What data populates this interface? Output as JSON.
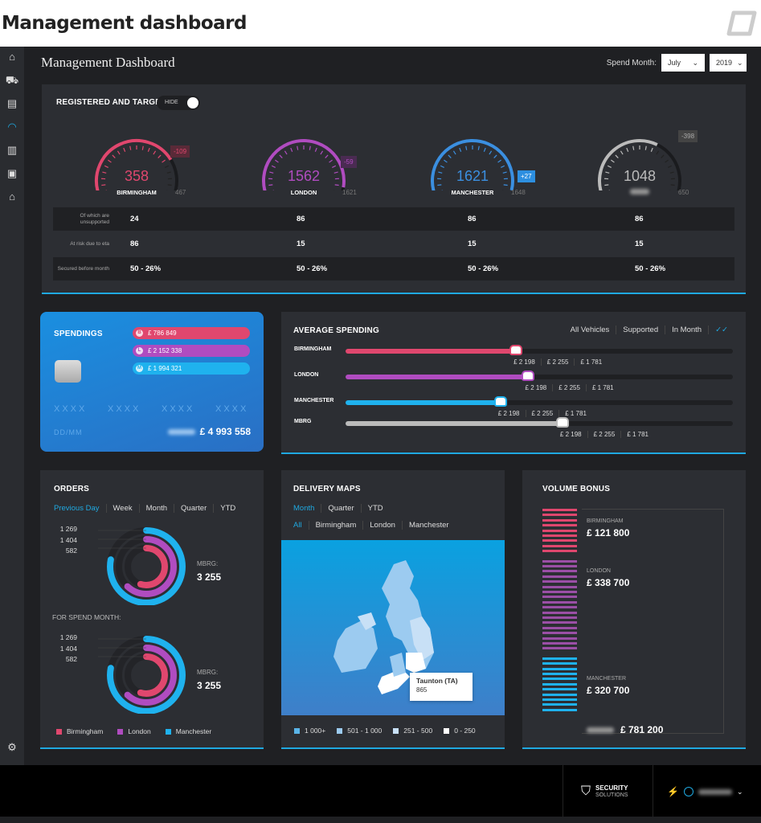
{
  "page_title": "Management dashboard",
  "header": {
    "title": "Management Dashboard",
    "spend_month_label": "Spend Month:",
    "month": "July",
    "year": "2019"
  },
  "sidebar": {
    "items": [
      {
        "icon": "home-icon",
        "glyph": "⌂"
      },
      {
        "icon": "car-icon",
        "glyph": "⛟"
      },
      {
        "icon": "list-icon",
        "glyph": "▤"
      },
      {
        "icon": "gauge-icon",
        "glyph": "◠"
      },
      {
        "icon": "bar-chart-icon",
        "glyph": "▥"
      },
      {
        "icon": "document-icon",
        "glyph": "▣"
      },
      {
        "icon": "lock-icon",
        "glyph": "⌂"
      }
    ],
    "settings_icon": "gear-icon"
  },
  "registered": {
    "title": "REGISTERED AND TARGET",
    "toggle_label": "HIDE",
    "gauges": [
      {
        "city": "BIRMINGHAM",
        "value": "358",
        "target": "467",
        "diff": "-109",
        "color": "#e0476e",
        "diff_bg": "#5a2a38",
        "diff_color": "#e0476e",
        "fraction": 0.77
      },
      {
        "city": "LONDON",
        "value": "1562",
        "target": "1621",
        "diff": "-59",
        "color": "#b04cc0",
        "diff_bg": "#4a2b52",
        "diff_color": "#b04cc0",
        "fraction": 0.96
      },
      {
        "city": "MANCHESTER",
        "value": "1621",
        "target": "1648",
        "diff": "+27",
        "color": "#3b8fe0",
        "diff_bg": "#2d8fe0",
        "diff_color": "#ffffff",
        "fraction": 0.98
      },
      {
        "city": "",
        "value": "1048",
        "target": "650",
        "diff": "-398",
        "color": "#bbbbbb",
        "diff_bg": "#444",
        "diff_color": "#aaa",
        "fraction": 0.62
      }
    ],
    "rows": [
      {
        "label": "Of which are unsupported",
        "values": [
          "24",
          "86",
          "86",
          "86"
        ]
      },
      {
        "label": "At risk due to eta",
        "values": [
          "86",
          "15",
          "15",
          "15"
        ]
      },
      {
        "label": "Secured before month",
        "values": [
          "50 - 26%",
          "50 - 26%",
          "50 - 26%",
          "50 - 26%"
        ]
      }
    ]
  },
  "spendings": {
    "title": "SPENDINGS",
    "items": [
      {
        "letter": "B",
        "amount": "£ 786 849",
        "color": "#e0476e"
      },
      {
        "letter": "L",
        "amount": "£ 2 152 338",
        "color": "#b04cc0"
      },
      {
        "letter": "M",
        "amount": "£ 1 994 321",
        "color": "#1fb2ee"
      }
    ],
    "card_number": [
      "XXXX",
      "XXXX",
      "XXXX",
      "XXXX"
    ],
    "expiry": "DD/MM",
    "total": "£ 4 993 558"
  },
  "average_spending": {
    "title": "AVERAGE SPENDING",
    "filters": [
      "All Vehicles",
      "Supported",
      "In Month"
    ],
    "check_icon": "double-check-icon",
    "rows": [
      {
        "name": "BIRMINGHAM",
        "fraction": 0.44,
        "color": "#e0476e",
        "values": [
          "£ 2 198",
          "£ 2 255",
          "£ 1 781"
        ]
      },
      {
        "name": "LONDON",
        "fraction": 0.47,
        "color": "#b04cc0",
        "values": [
          "£ 2 198",
          "£ 2 255",
          "£ 1 781"
        ]
      },
      {
        "name": "MANCHESTER",
        "fraction": 0.4,
        "color": "#1fb2ee",
        "values": [
          "£ 2 198",
          "£ 2 255",
          "£ 1 781"
        ]
      },
      {
        "name": "MBRG",
        "fraction": 0.56,
        "color": "#bbbbbb",
        "values": [
          "£ 2 198",
          "£ 2 255",
          "£ 1 781"
        ]
      }
    ]
  },
  "orders": {
    "title": "ORDERS",
    "tabs": [
      "Previous Day",
      "Week",
      "Month",
      "Quarter",
      "YTD"
    ],
    "active_tab": "Previous Day",
    "charts": [
      {
        "heading": "",
        "ring_labels": [
          "1 269",
          "1 404",
          "582"
        ],
        "total_label": "MBRG:",
        "total": "3 255"
      },
      {
        "heading": "FOR SPEND MONTH:",
        "ring_labels": [
          "1 269",
          "1 404",
          "582"
        ],
        "total_label": "MBRG:",
        "total": "3 255"
      }
    ],
    "rings": [
      {
        "name": "Manchester",
        "color": "#1fb2ee",
        "fraction": 0.78
      },
      {
        "name": "London",
        "color": "#b04cc0",
        "fraction": 0.62
      },
      {
        "name": "Birmingham",
        "color": "#e0476e",
        "fraction": 0.55
      }
    ],
    "legend": [
      {
        "name": "Birmingham",
        "color": "#e0476e"
      },
      {
        "name": "London",
        "color": "#b04cc0"
      },
      {
        "name": "Manchester",
        "color": "#1fb2ee"
      }
    ]
  },
  "delivery": {
    "title": "DELIVERY MAPS",
    "period_tabs": [
      "Month",
      "Quarter",
      "YTD"
    ],
    "region_tabs": [
      "All",
      "Birmingham",
      "London",
      "Manchester"
    ],
    "tooltip": {
      "name": "Taunton (TA)",
      "value": "865"
    },
    "legend": [
      {
        "label": "1 000+",
        "color": "#5ab4e8"
      },
      {
        "label": "501 - 1 000",
        "color": "#9ccbf0"
      },
      {
        "label": "251 - 500",
        "color": "#c8e0f6"
      },
      {
        "label": "0 - 250",
        "color": "#ffffff"
      }
    ]
  },
  "volume_bonus": {
    "title": "VOLUME BONUS",
    "items": [
      {
        "city": "BIRMINGHAM",
        "amount": "£ 121 800",
        "color": "#e0476e",
        "lines": 9
      },
      {
        "city": "LONDON",
        "amount": "£ 338 700",
        "color": "#9b4fa6",
        "lines": 18
      },
      {
        "city": "MANCHESTER",
        "amount": "£ 320 700",
        "color": "#1fb2ee",
        "lines": 11
      }
    ],
    "total": "£ 781 200"
  },
  "footer": {
    "brand_top": "SECURITY",
    "brand_bottom": "SOLUTIONS"
  }
}
